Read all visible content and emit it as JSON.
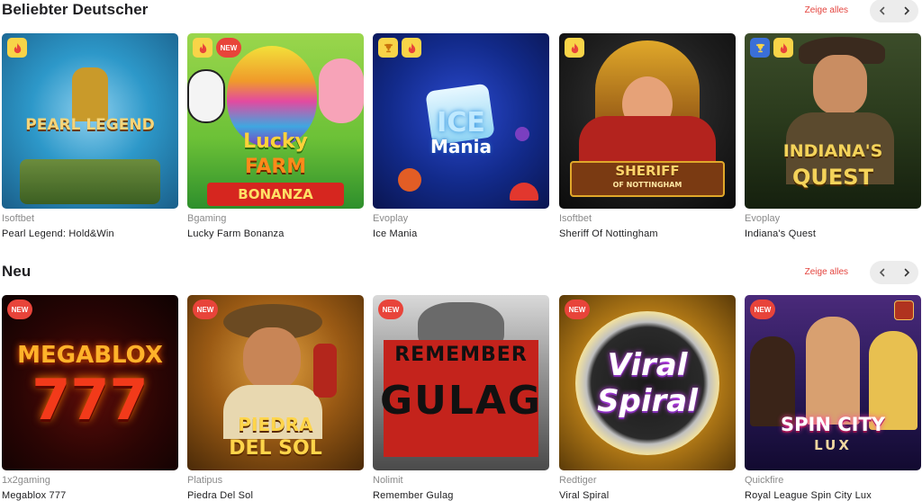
{
  "sections": [
    {
      "title": "Beliebter Deutscher",
      "show_all": "Zeige alles",
      "games": [
        {
          "provider": "Isoftbet",
          "name": "Pearl Legend: Hold&Win",
          "art_text": [
            "PEARL LEGEND"
          ],
          "badges": [
            "fire"
          ]
        },
        {
          "provider": "Bgaming",
          "name": "Lucky Farm Bonanza",
          "art_text": [
            "Lucky",
            "FARM",
            "BONANZA"
          ],
          "badges": [
            "fire",
            "new"
          ]
        },
        {
          "provider": "Evoplay",
          "name": "Ice Mania",
          "art_text": [
            "ICE",
            "Mania"
          ],
          "badges": [
            "trophy",
            "fire"
          ]
        },
        {
          "provider": "Isoftbet",
          "name": "Sheriff Of Nottingham",
          "art_text": [
            "SHERIFF",
            "OF NOTTINGHAM"
          ],
          "badges": [
            "fire"
          ]
        },
        {
          "provider": "Evoplay",
          "name": "Indiana's Quest",
          "art_text": [
            "INDIANA'S",
            "QUEST"
          ],
          "badges": [
            "trophy-blue",
            "fire"
          ]
        }
      ]
    },
    {
      "title": "Neu",
      "show_all": "Zeige alles",
      "games": [
        {
          "provider": "1x2gaming",
          "name": "Megablox 777",
          "art_text": [
            "MEGABLOX",
            "777"
          ],
          "badges": [
            "new"
          ]
        },
        {
          "provider": "Platipus",
          "name": "Piedra Del Sol",
          "art_text": [
            "PIEDRA",
            "DEL SOL"
          ],
          "badges": [
            "new"
          ]
        },
        {
          "provider": "Nolimit",
          "name": "Remember Gulag",
          "art_text": [
            "REMEMBER",
            "GULAG"
          ],
          "badges": [
            "new"
          ]
        },
        {
          "provider": "Redtiger",
          "name": "Viral Spiral",
          "art_text": [
            "Viral",
            "Spiral"
          ],
          "badges": [
            "new"
          ]
        },
        {
          "provider": "Quickfire",
          "name": "Royal League Spin City Lux",
          "art_text": [
            "SPIN CITY",
            "LUX"
          ],
          "badges": [
            "new"
          ]
        }
      ]
    }
  ],
  "labels": {
    "new": "NEW"
  },
  "icons": {
    "prev": "chevron-left-icon",
    "next": "chevron-right-icon",
    "fire": "fire-icon",
    "trophy": "trophy-icon"
  },
  "colors": {
    "accent": "#e4443e",
    "badge_yellow": "#f8d448",
    "badge_blue": "#3a6fd8",
    "badge_new": "#e8443a"
  }
}
